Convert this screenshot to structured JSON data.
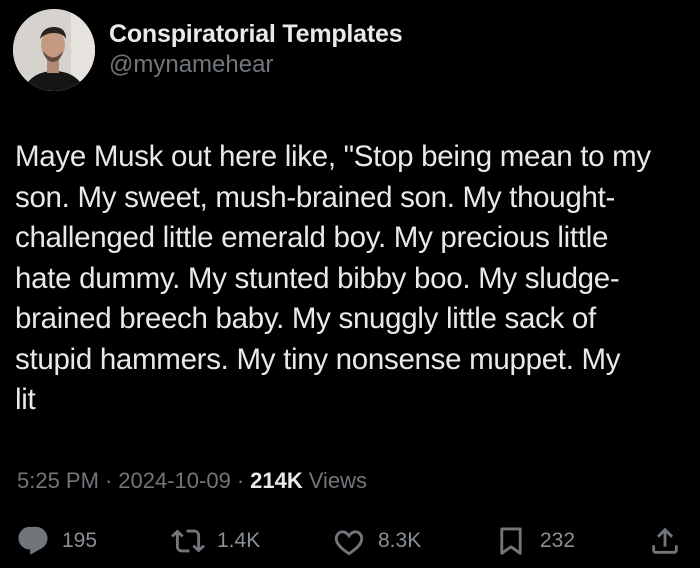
{
  "author": {
    "display_name": "Conspiratorial Templates",
    "handle": "@mynamehear"
  },
  "tweet": {
    "text": "Maye Musk out here like, \"Stop being mean to my son. My sweet, mush-brained son. My thought-challenged little emerald boy. My precious little hate dummy. My stunted bibby boo. My sludge-brained breech baby. My snuggly little sack of stupid hammers. My tiny nonsense muppet. My lit",
    "lines": [
      "Maye Musk out here like, \"Stop being mean to my",
      "son. My sweet, mush-brained son. My thought-",
      "challenged little emerald boy. My precious little",
      "hate dummy. My stunted bibby boo. My sludge-",
      "brained breech baby. My snuggly little sack of",
      "stupid hammers. My tiny nonsense muppet. My",
      "lit"
    ]
  },
  "meta": {
    "time": "5:25 PM",
    "separator": "·",
    "date": "2024-10-09",
    "views_count": "214K",
    "views_label": "Views"
  },
  "actions": {
    "reply": {
      "icon": "reply-icon",
      "count": "195"
    },
    "retweet": {
      "icon": "retweet-icon",
      "count": "1.4K"
    },
    "like": {
      "icon": "heart-icon",
      "count": "8.3K"
    },
    "bookmark": {
      "icon": "bookmark-icon",
      "count": "232"
    },
    "share": {
      "icon": "share-icon"
    }
  },
  "colors": {
    "background": "#000000",
    "primary_text": "#e7e9ea",
    "secondary_text": "#71767b"
  }
}
